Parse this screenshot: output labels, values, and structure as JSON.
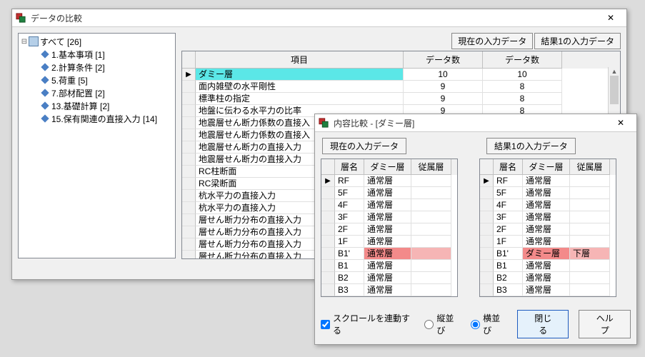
{
  "win1": {
    "title": "データの比較",
    "tree": {
      "root": "すべて [26]",
      "items": [
        "1.基本事項 [1]",
        "2.計算条件 [2]",
        "5.荷重 [5]",
        "7.部材配置 [2]",
        "13.基礎計算 [2]",
        "15.保有関連の直接入力 [14]"
      ]
    },
    "hbtn1": "現在の入力データ",
    "hbtn2": "結果1の入力データ",
    "cols": {
      "item": "項目",
      "d1": "データ数",
      "d2": "データ数"
    },
    "rows": [
      {
        "name": "ダミー層",
        "a": "10",
        "b": "10",
        "mark": "▶",
        "hl": "cyan"
      },
      {
        "name": "面内雑壁の水平剛性",
        "a": "9",
        "b": "8"
      },
      {
        "name": "標準柱の指定",
        "a": "9",
        "b": "8"
      },
      {
        "name": "地盤に伝わる水平力の比率",
        "a": "9",
        "b": "8"
      },
      {
        "name": "地震層せん断力係数の直接入",
        "a": "",
        "b": ""
      },
      {
        "name": "地震層せん断力係数の直接入",
        "a": "",
        "b": ""
      },
      {
        "name": "地震層せん断力の直接入力<X",
        "a": "",
        "b": ""
      },
      {
        "name": "地震層せん断力の直接入力<Y",
        "a": "",
        "b": ""
      },
      {
        "name": "RC柱断面",
        "a": "",
        "b": ""
      },
      {
        "name": "RC梁断面",
        "a": "",
        "b": ""
      },
      {
        "name": "杭水平力の直接入力<X加力>",
        "a": "",
        "b": ""
      },
      {
        "name": "杭水平力の直接入力<Y加力>",
        "a": "",
        "b": ""
      },
      {
        "name": "層せん断力分布の直接入力<D",
        "a": "",
        "b": ""
      },
      {
        "name": "層せん断力分布の直接入力<D",
        "a": "",
        "b": ""
      },
      {
        "name": "層せん断力分布の直接入力<D",
        "a": "",
        "b": ""
      },
      {
        "name": "層せん断力分布の直接入力<D",
        "a": "",
        "b": ""
      }
    ]
  },
  "win2": {
    "title": "内容比較 - [ダミー層]",
    "p1": "現在の入力データ",
    "p2": "結果1の入力データ",
    "cols": {
      "a": "層名",
      "b": "ダミー層",
      "c": "従属層"
    },
    "left": [
      {
        "a": "RF",
        "b": "通常層",
        "c": "",
        "mark": "▶"
      },
      {
        "a": "5F",
        "b": "通常層",
        "c": ""
      },
      {
        "a": "4F",
        "b": "通常層",
        "c": ""
      },
      {
        "a": "3F",
        "b": "通常層",
        "c": ""
      },
      {
        "a": "2F",
        "b": "通常層",
        "c": ""
      },
      {
        "a": "1F",
        "b": "通常層",
        "c": ""
      },
      {
        "a": "B1'",
        "b": "通常層",
        "c": "",
        "hl": "red"
      },
      {
        "a": "B1",
        "b": "通常層",
        "c": ""
      },
      {
        "a": "B2",
        "b": "通常層",
        "c": ""
      },
      {
        "a": "B3",
        "b": "通常層",
        "c": ""
      }
    ],
    "right": [
      {
        "a": "RF",
        "b": "通常層",
        "c": "",
        "mark": "▶"
      },
      {
        "a": "5F",
        "b": "通常層",
        "c": ""
      },
      {
        "a": "4F",
        "b": "通常層",
        "c": ""
      },
      {
        "a": "3F",
        "b": "通常層",
        "c": ""
      },
      {
        "a": "2F",
        "b": "通常層",
        "c": ""
      },
      {
        "a": "1F",
        "b": "通常層",
        "c": ""
      },
      {
        "a": "B1'",
        "b": "ダミー層",
        "c": "下層",
        "hl": "red"
      },
      {
        "a": "B1",
        "b": "通常層",
        "c": ""
      },
      {
        "a": "B2",
        "b": "通常層",
        "c": ""
      },
      {
        "a": "B3",
        "b": "通常層",
        "c": ""
      }
    ],
    "scrollSync": "スクロールを連動する",
    "vertical": "縦並び",
    "horizontal": "横並び",
    "close": "閉じる",
    "help": "ヘルプ"
  }
}
